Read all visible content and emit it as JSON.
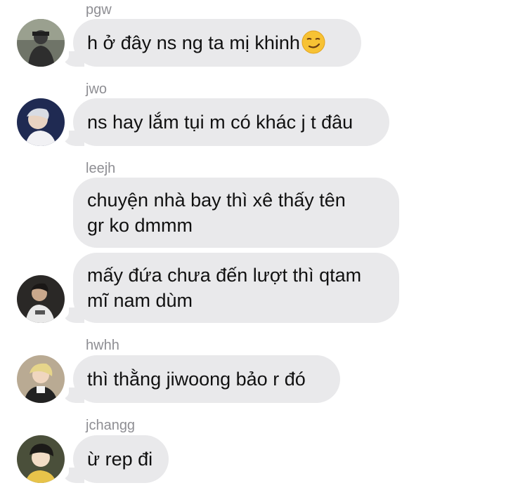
{
  "messages": [
    {
      "sender": "pgw",
      "lines": [
        "h ở đây ns ng ta mị khinh"
      ],
      "emoji": "smirking-face-icon"
    },
    {
      "sender": "jwo",
      "lines": [
        "ns hay lắm tụi m có khác j t đâu"
      ]
    },
    {
      "sender": "leejh",
      "lines": [
        "chuyện nhà bay thì xê thấy tên",
        "gr ko dmmm"
      ]
    },
    {
      "sender": "",
      "lines": [
        "mấy đứa chưa đến lượt thì qtam",
        "mĩ nam dùm"
      ]
    },
    {
      "sender": "hwhh",
      "lines": [
        "thì thằng jiwoong bảo r đó"
      ]
    },
    {
      "sender": "jchangg",
      "lines": [
        "ừ rep đi"
      ]
    }
  ],
  "colors": {
    "bubble": "#e9e9eb",
    "sender_text": "#8e8e93",
    "message_text": "#111111"
  }
}
